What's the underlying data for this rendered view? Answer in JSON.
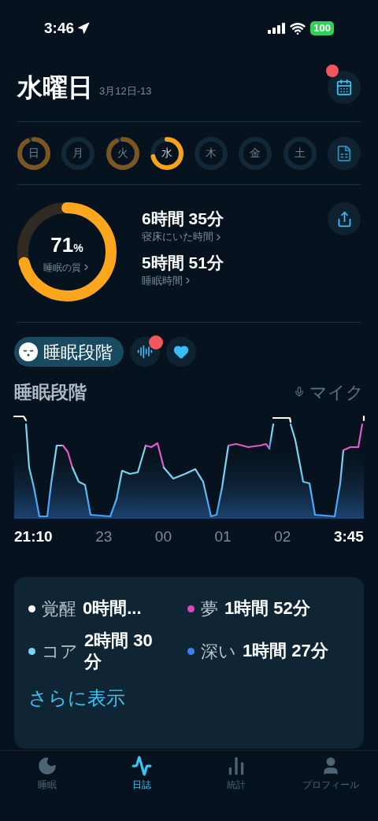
{
  "status_bar": {
    "time": "3:46",
    "battery": "100"
  },
  "header": {
    "title": "水曜日",
    "date_range": "3月12日-13",
    "calendar_notification": true
  },
  "days": [
    {
      "label": "日",
      "level": 0.92,
      "selected": false
    },
    {
      "label": "月",
      "selected": false
    },
    {
      "label": "火",
      "level": 0.92,
      "selected": false
    },
    {
      "label": "水",
      "level": 0.71,
      "selected": true
    },
    {
      "label": "木",
      "selected": false
    },
    {
      "label": "金",
      "selected": false
    },
    {
      "label": "土",
      "selected": false
    }
  ],
  "summary": {
    "quality": {
      "value": "71",
      "unit": "%",
      "label": "睡眠の質",
      "level": 0.71
    },
    "stats": [
      {
        "value": "6時間 35分",
        "label": "寝床にいた時間"
      },
      {
        "value": "5時間 51分",
        "label": "睡眠時間"
      }
    ]
  },
  "stage_tabs": [
    {
      "kind": "stages",
      "label": "睡眠段階",
      "selected": true,
      "notification": false
    },
    {
      "kind": "sound",
      "selected": false,
      "notification": true
    },
    {
      "kind": "heart",
      "selected": false,
      "notification": false
    }
  ],
  "chart_section": {
    "title": "睡眠段階",
    "source": "マイク",
    "x_labels": [
      {
        "label": "21:10",
        "emphasis": true
      },
      {
        "label": "23",
        "emphasis": false
      },
      {
        "label": "00",
        "emphasis": false
      },
      {
        "label": "01",
        "emphasis": false
      },
      {
        "label": "02",
        "emphasis": false
      },
      {
        "label": "3:45",
        "emphasis": true
      }
    ]
  },
  "legend": [
    {
      "label": "覚醒",
      "value": "0時間...",
      "color": "#ffffff"
    },
    {
      "label": "夢",
      "value": "1時間 52分",
      "color": "#d946c4"
    },
    {
      "label": "コア",
      "value": "2時間 30分",
      "color": "#7dd3f0"
    },
    {
      "label": "深い",
      "value": "1時間 27分",
      "color": "#3b82f6"
    }
  ],
  "more_link": "さらに表示",
  "tab_bar": [
    {
      "kind": "moon",
      "label": "睡眠",
      "selected": false
    },
    {
      "kind": "wave",
      "label": "日誌",
      "selected": true
    },
    {
      "kind": "stats",
      "label": "統計",
      "selected": false
    },
    {
      "kind": "profile",
      "label": "プロフィール",
      "selected": false
    }
  ]
}
